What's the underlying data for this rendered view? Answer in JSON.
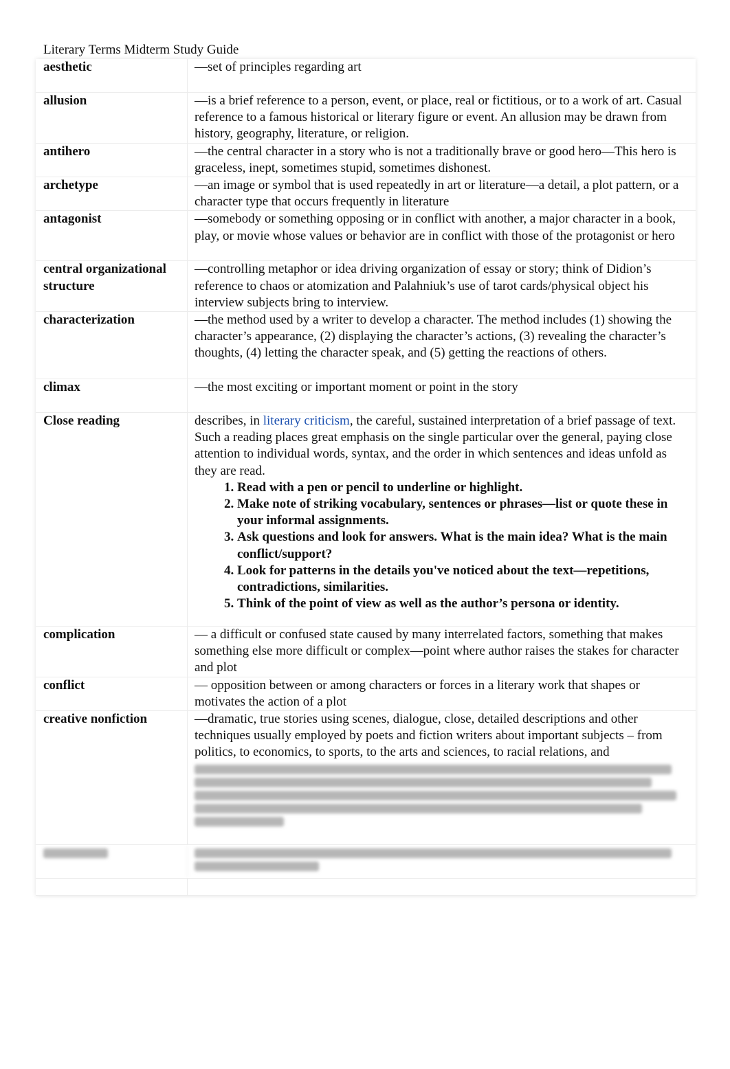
{
  "title": "Literary Terms Midterm Study Guide",
  "entries": [
    {
      "term": "aesthetic",
      "definition": "—set of principles regarding art"
    },
    {
      "term": "allusion",
      "definition": "—is a brief reference to a person, event, or place, real or fictitious, or to a work of art. Casual reference to a famous historical or literary figure or event. An allusion may be drawn from history, geography, literature, or religion."
    },
    {
      "term": "antihero",
      "definition": "—the central character in a story who is not a traditionally brave or good hero—This hero is graceless, inept, sometimes stupid, sometimes dishonest."
    },
    {
      "term": "archetype",
      "definition": "—an image or symbol that is used repeatedly in art or literature—a detail, a plot pattern, or a character type that occurs frequently in literature"
    },
    {
      "term": "antagonist",
      "definition": "—somebody or something opposing or in conflict with another, a major character in a book, play, or movie whose values or behavior are in conflict with those of the protagonist or hero"
    },
    {
      "term": "central organizational structure",
      "definition": "—controlling metaphor or idea driving organization of essay or story; think of Didion’s reference to chaos or atomization and Palahniuk’s use of tarot cards/physical object his interview subjects bring to interview."
    },
    {
      "term": "characterization",
      "definition": "—the method used by a writer to develop a character. The method includes (1) showing the character’s appearance, (2) displaying the character’s actions, (3) revealing the character’s thoughts, (4) letting the character speak, and (5) getting the reactions of others."
    },
    {
      "term": "climax",
      "definition": "—the most exciting or important moment or point in the story"
    }
  ],
  "close_reading": {
    "term": "Close reading",
    "before_link": "describes, in ",
    "link": "literary criticism",
    "after_link": ", the careful, sustained interpretation of a brief passage of text. Such a reading places great emphasis on the single particular over the general, paying close attention to individual words, syntax, and the order in which sentences and ideas unfold as they are read.",
    "steps": [
      "Read with a pen or pencil to underline or highlight.",
      "Make note of striking vocabulary, sentences or phrases—list or quote these in your informal assignments.",
      "Ask questions and look for answers. What is the main idea? What is the main conflict/support?",
      "Look for patterns in the details you've noticed about the text—repetitions, contradictions, similarities.",
      "Think of the point of view as well as the author’s persona or identity."
    ]
  },
  "entries2": [
    {
      "term": "complication",
      "definition": "— a difficult or confused state caused by many interrelated factors, something that makes something else more difficult or complex—point where author raises the stakes for character and plot"
    },
    {
      "term": "conflict",
      "definition": "— opposition between or among characters or forces in a literary work that shapes or motivates the action of a plot"
    },
    {
      "term": "creative nonfiction",
      "definition": "—dramatic, true stories using scenes, dialogue, close, detailed descriptions and other techniques usually employed by poets and fiction writers about important subjects – from politics, to economics, to sports, to the arts and sciences, to racial relations, and"
    }
  ],
  "colors": {
    "link": "#1a4fb0"
  }
}
